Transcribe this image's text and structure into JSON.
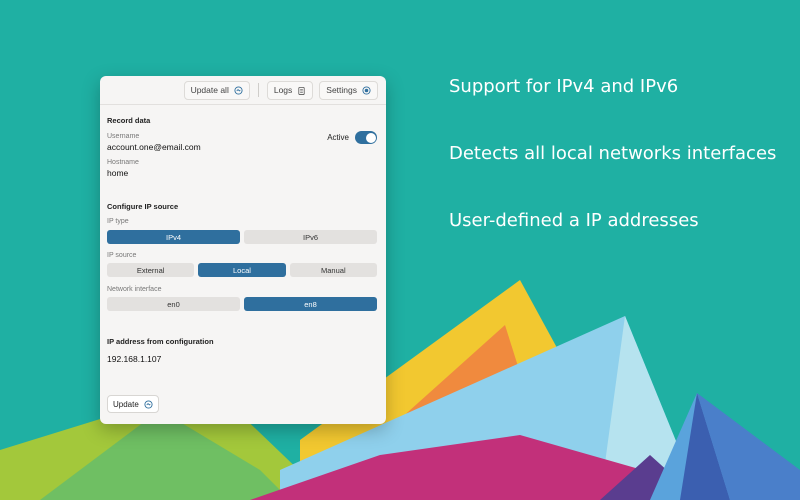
{
  "features": [
    {
      "text": "Support for IPv4 and IPv6"
    },
    {
      "text": "Detects all local networks interfaces"
    },
    {
      "text": "User-defined a IP addresses"
    }
  ],
  "toolbar": {
    "update_all_label": "Update all",
    "logs_label": "Logs",
    "settings_label": "Settings"
  },
  "record": {
    "title": "Record data",
    "username_label": "Username",
    "username_value": "account.one@email.com",
    "hostname_label": "Hostname",
    "hostname_value": "home",
    "active_label": "Active",
    "active": true
  },
  "config": {
    "title": "Configure IP source",
    "ip_type_label": "IP type",
    "ip_type_options": [
      {
        "label": "IPv4",
        "selected": true
      },
      {
        "label": "IPv6",
        "selected": false
      }
    ],
    "ip_source_label": "IP source",
    "ip_source_options": [
      {
        "label": "External",
        "selected": false
      },
      {
        "label": "Local",
        "selected": true
      },
      {
        "label": "Manual",
        "selected": false
      }
    ],
    "interface_label": "Network interface",
    "interface_options": [
      {
        "label": "en0",
        "selected": false
      },
      {
        "label": "en8",
        "selected": true
      }
    ]
  },
  "ip_result": {
    "title": "IP address from configuration",
    "value": "192.168.1.107"
  },
  "update_label": "Update",
  "colors": {
    "background": "#1fb0a3",
    "accent": "#2f6f9e",
    "panel": "#f6f5f4"
  }
}
